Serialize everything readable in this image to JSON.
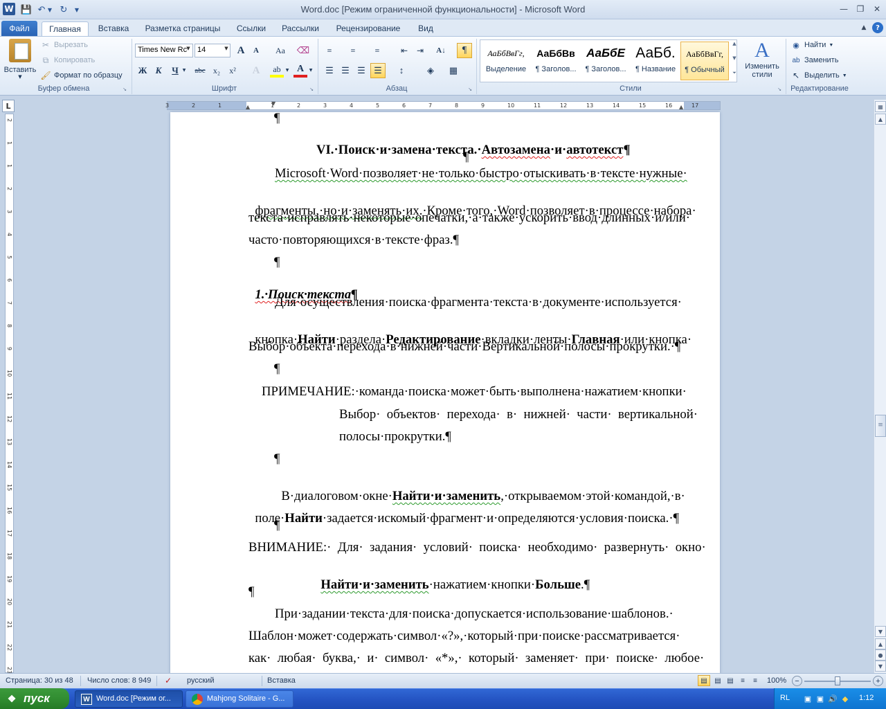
{
  "window": {
    "title": "Word.doc [Режим ограниченной функциональности] - Microsoft Word",
    "app_icon": "W"
  },
  "tabs": [
    {
      "label": "Файл"
    },
    {
      "label": "Главная"
    },
    {
      "label": "Вставка"
    },
    {
      "label": "Разметка страницы"
    },
    {
      "label": "Ссылки"
    },
    {
      "label": "Рассылки"
    },
    {
      "label": "Рецензирование"
    },
    {
      "label": "Вид"
    }
  ],
  "clipboard": {
    "paste": "Вставить",
    "cut": "Вырезать",
    "copy": "Копировать",
    "format_painter": "Формат по образцу",
    "group_label": "Буфер обмена"
  },
  "font": {
    "family": "Times New Rc",
    "size": "14",
    "group_label": "Шрифт",
    "bold": "Ж",
    "italic": "К",
    "underline": "Ч",
    "strike": "abc",
    "sub": "x₂",
    "sup": "x²",
    "grow": "A",
    "shrink": "A",
    "case": "Aa"
  },
  "paragraph": {
    "group_label": "Абзац",
    "pilcrow": "¶"
  },
  "styles": {
    "group_label": "Стили",
    "items": [
      {
        "preview": "АаБбВвГг,",
        "name": "Выделение"
      },
      {
        "preview": "АаБбВв",
        "name": "¶ Заголов..."
      },
      {
        "preview": "АаБбЕ",
        "name": "¶ Заголов..."
      },
      {
        "preview": "АаБб.",
        "name": "¶ Название"
      },
      {
        "preview": "АаБбВвГг,",
        "name": "¶ Обычный"
      }
    ],
    "change": "Изменить стили"
  },
  "editing": {
    "group_label": "Редактирование",
    "find": "Найти",
    "replace": "Заменить",
    "select": "Выделить"
  },
  "ruler": {
    "numbers": [
      "3",
      "2",
      "1",
      "1",
      "2",
      "3",
      "4",
      "5",
      "6",
      "7",
      "8",
      "9",
      "10",
      "11",
      "12",
      "13",
      "14",
      "15",
      "16",
      "17"
    ],
    "vnumbers": [
      "2",
      "1",
      "1",
      "2",
      "3",
      "4",
      "5",
      "6",
      "7",
      "8",
      "9",
      "10",
      "11",
      "12",
      "13",
      "14",
      "15",
      "16",
      "17",
      "18",
      "19",
      "20",
      "21",
      "22",
      "23"
    ]
  },
  "document": {
    "l0": "¶",
    "heading": "VI.·Поиск·и·замена·текста.·",
    "heading_b": "Автозамена",
    "heading_c": "·и·",
    "heading_d": "автотекст",
    "heading_e": "¶",
    "l2": "¶",
    "p1_1a": "Microsoft·Word·позволяет·не·только·быстро·отыскивать·в·тексте·нужные·",
    "p1_2a": "фрагменты,·но·и·заменять·их.",
    "p1_2b": "·Кроме·того,·Word·позволяет·в·процессе·набора·",
    "p1_3": "текста·исправлять·некоторые·опечатки,·а·также·ускорить·ввод·длинных·и/или·",
    "p1_4": "часто·повторяющихся·в·тексте·фраз.¶",
    "l7": "¶",
    "h2": "1.·Поиск·текста",
    "h2_pm": "¶",
    "p2_1": "Для·осуществления·поиска·фрагмента·текста·в·документе·используется·",
    "p2_2a": "кнопка·",
    "p2_2b": "Найти",
    "p2_2c": "·раздела·",
    "p2_2d": "Редактирование",
    "p2_2e": "·вкладки·ленты·",
    "p2_2f": "Главная",
    "p2_2g": "·или·кнопка·",
    "p2_3": "Выбор·объекта·перехода·в·нижней·части·Вертикальной·полосы·прокрутки.·¶",
    "l12": "¶",
    "note1": "ПРИМЕЧАНИЕ:·команда·поиска·может·быть·выполнена·нажатием·кнопки·",
    "note2": "Выбор·  объектов·  перехода·  в·  нижней·  части·  вертикальной·",
    "note3": "полосы·прокрутки.¶",
    "l16": "¶",
    "p3_1a": "В·диалоговом·окне·",
    "p3_1b": "Найти·и·заменить",
    "p3_1c": ",·открываемом·этой·командой,·в·",
    "p3_2a": "поле·",
    "p3_2b": "Найти",
    "p3_2c": "·задается·искомый·фрагмент·и·определяются·условия·поиска.·¶",
    "l19": "¶",
    "warn1": "ВНИМАНИЕ:·  Для·  задания·  условий·  поиска·  необходимо·  развернуть·  окно·",
    "warn2a": "Найти·и·заменить",
    "warn2b": "·нажатием·кнопки·",
    "warn2c": "Больше",
    "warn2d": ".¶",
    "l22": "¶",
    "p4_1": "При·задании·текста·для·поиска·допускается·использование·шаблонов.·",
    "p4_2": "Шаблон·может·содержать·символ·«?»,·который·при·поиске·рассматривается·",
    "p4_3": "как·  любая·  буква,·  и·  символ·  «*»,·  который·  заменяет·  при·  поиске·  любое·"
  },
  "status": {
    "page": "Страница: 30 из 48",
    "words": "Число слов: 8 949",
    "lang": "русский",
    "mode": "Вставка",
    "zoom": "100%"
  },
  "taskbar": {
    "start": "пуск",
    "task1": "Word.doc [Режим ог...",
    "task2": "Mahjong Solitaire - G...",
    "lang": "RL",
    "time": "1:12"
  }
}
